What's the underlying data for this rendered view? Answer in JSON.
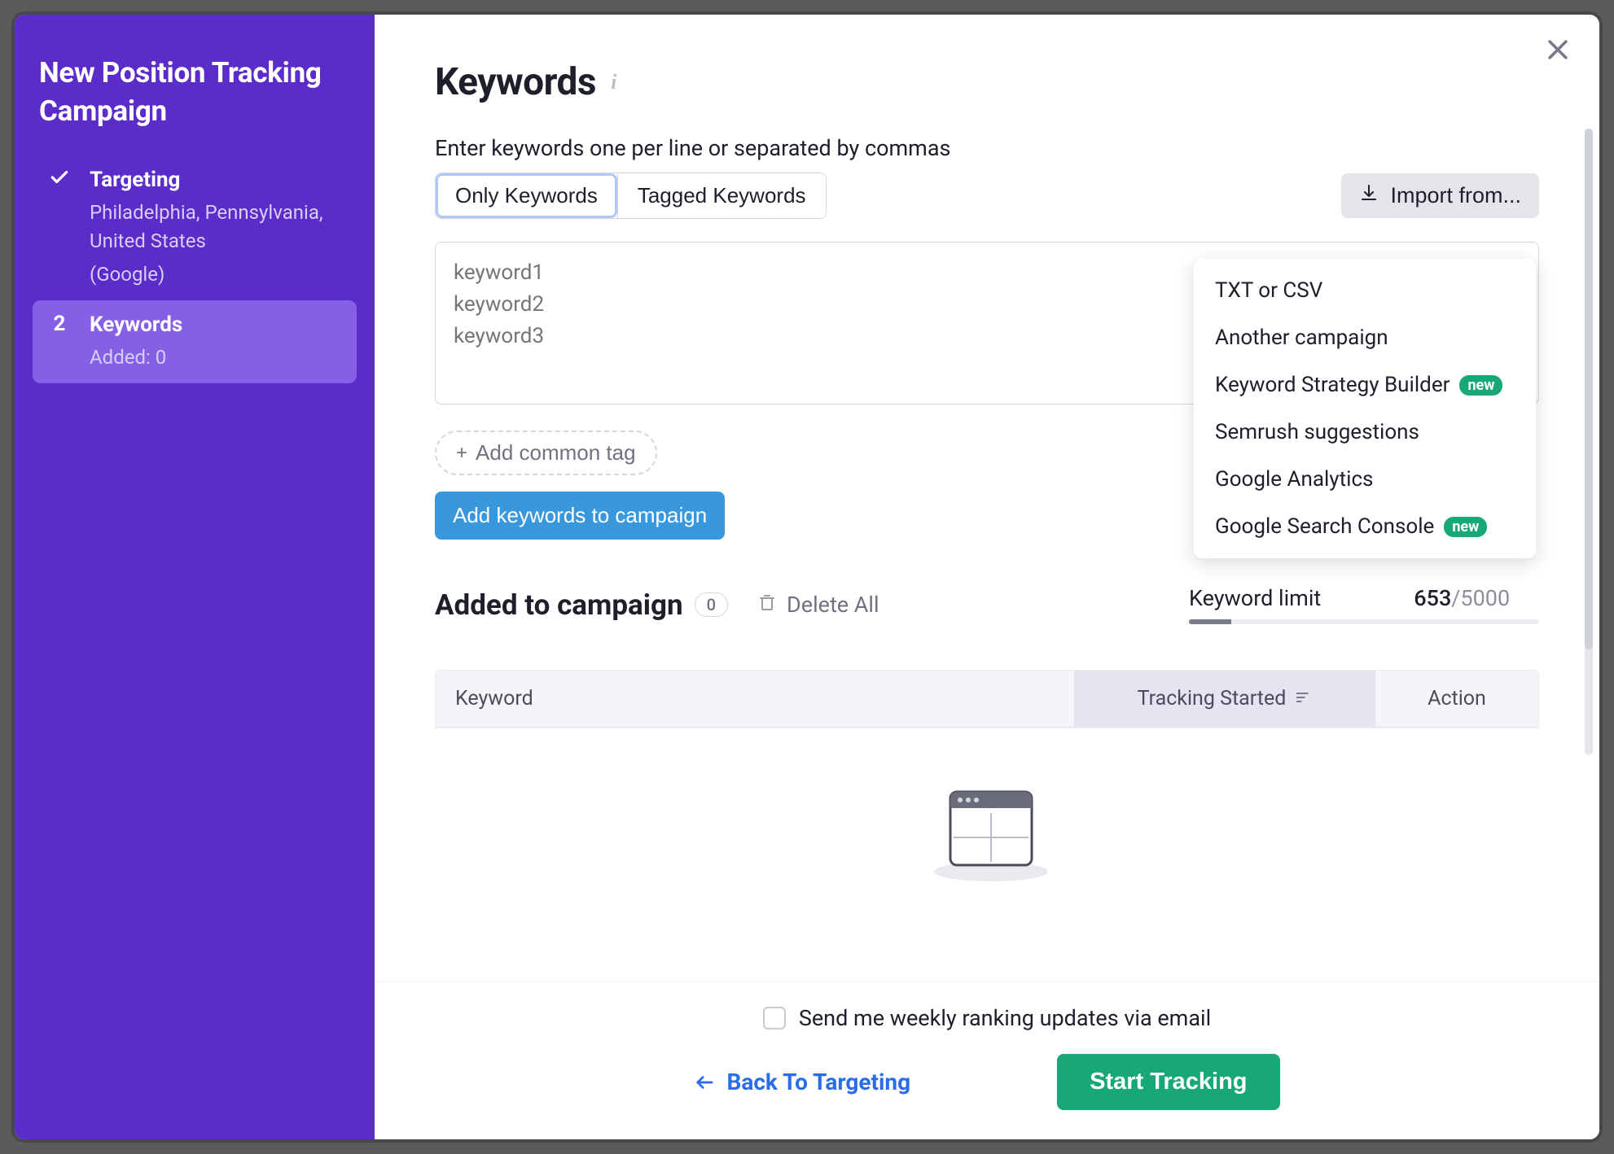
{
  "sidebar": {
    "title": "New Position Tracking Campaign",
    "steps": [
      {
        "label": "Targeting",
        "sub1": "Philadelphia, Pennsylvania, United States",
        "sub2": "(Google)"
      },
      {
        "num": "2",
        "label": "Keywords",
        "sub": "Added: 0"
      }
    ]
  },
  "main": {
    "heading": "Keywords",
    "helper": "Enter keywords one per line or separated by commas",
    "tabs": {
      "only": "Only Keywords",
      "tagged": "Tagged Keywords"
    },
    "import_label": "Import from...",
    "dropdown": {
      "txt": "TXT or CSV",
      "another": "Another campaign",
      "ksb": "Keyword Strategy Builder",
      "sugg": "Semrush suggestions",
      "ga": "Google Analytics",
      "gsc": "Google Search Console",
      "new_badge": "new"
    },
    "textarea_placeholder": "keyword1\nkeyword2\nkeyword3",
    "add_tag": "Add common tag",
    "add_kw": "Add keywords to campaign",
    "added": {
      "heading": "Added to campaign",
      "count": "0",
      "delete_all": "Delete All"
    },
    "limit": {
      "label": "Keyword limit",
      "used": "653",
      "total": "/5000"
    },
    "table": {
      "keyword": "Keyword",
      "tracking": "Tracking Started",
      "action": "Action"
    }
  },
  "footer": {
    "weekly": "Send me weekly ranking updates via email",
    "back": "Back To Targeting",
    "start": "Start Tracking"
  }
}
